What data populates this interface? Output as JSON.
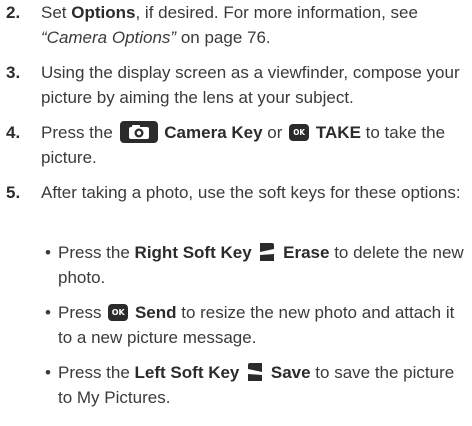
{
  "steps": [
    {
      "number": "2.",
      "segments": [
        {
          "t": "Set ",
          "s": "n"
        },
        {
          "t": "Options",
          "s": "b"
        },
        {
          "t": ", if desired. For more information, see ",
          "s": "n"
        },
        {
          "t": "“Camera Options”",
          "s": "i"
        },
        {
          "t": " on page 76.",
          "s": "n"
        }
      ]
    },
    {
      "number": "3.",
      "text": "Using the display screen as a viewfinder, compose your picture by aiming the lens at your subject."
    },
    {
      "number": "4.",
      "p1": "Press the",
      "camera_key": "Camera Key",
      "p2": "or",
      "ok_label": "OK",
      "take": "TAKE",
      "p3": "to take the picture."
    },
    {
      "number": "5.",
      "text": "After taking a photo, use the soft keys for these options:"
    }
  ],
  "bullets": [
    {
      "dot": "•",
      "p1": "Press the",
      "key": "Right Soft Key",
      "action": "Erase",
      "p2": "to delete the new photo."
    },
    {
      "dot": "•",
      "p1": "Press",
      "ok_label": "OK",
      "action": "Send",
      "p2": "to resize the new photo and attach it to a new picture message."
    },
    {
      "dot": "•",
      "p1": "Press the",
      "key": "Left Soft Key",
      "action": "Save",
      "p2": "to save the picture to My Pictures."
    }
  ],
  "colors": {
    "text": "#3a3a3a",
    "key_fill": "#2b2b2b"
  },
  "icons": [
    "camera-key-icon",
    "ok-key-icon",
    "right-soft-key-icon",
    "left-soft-key-icon"
  ]
}
